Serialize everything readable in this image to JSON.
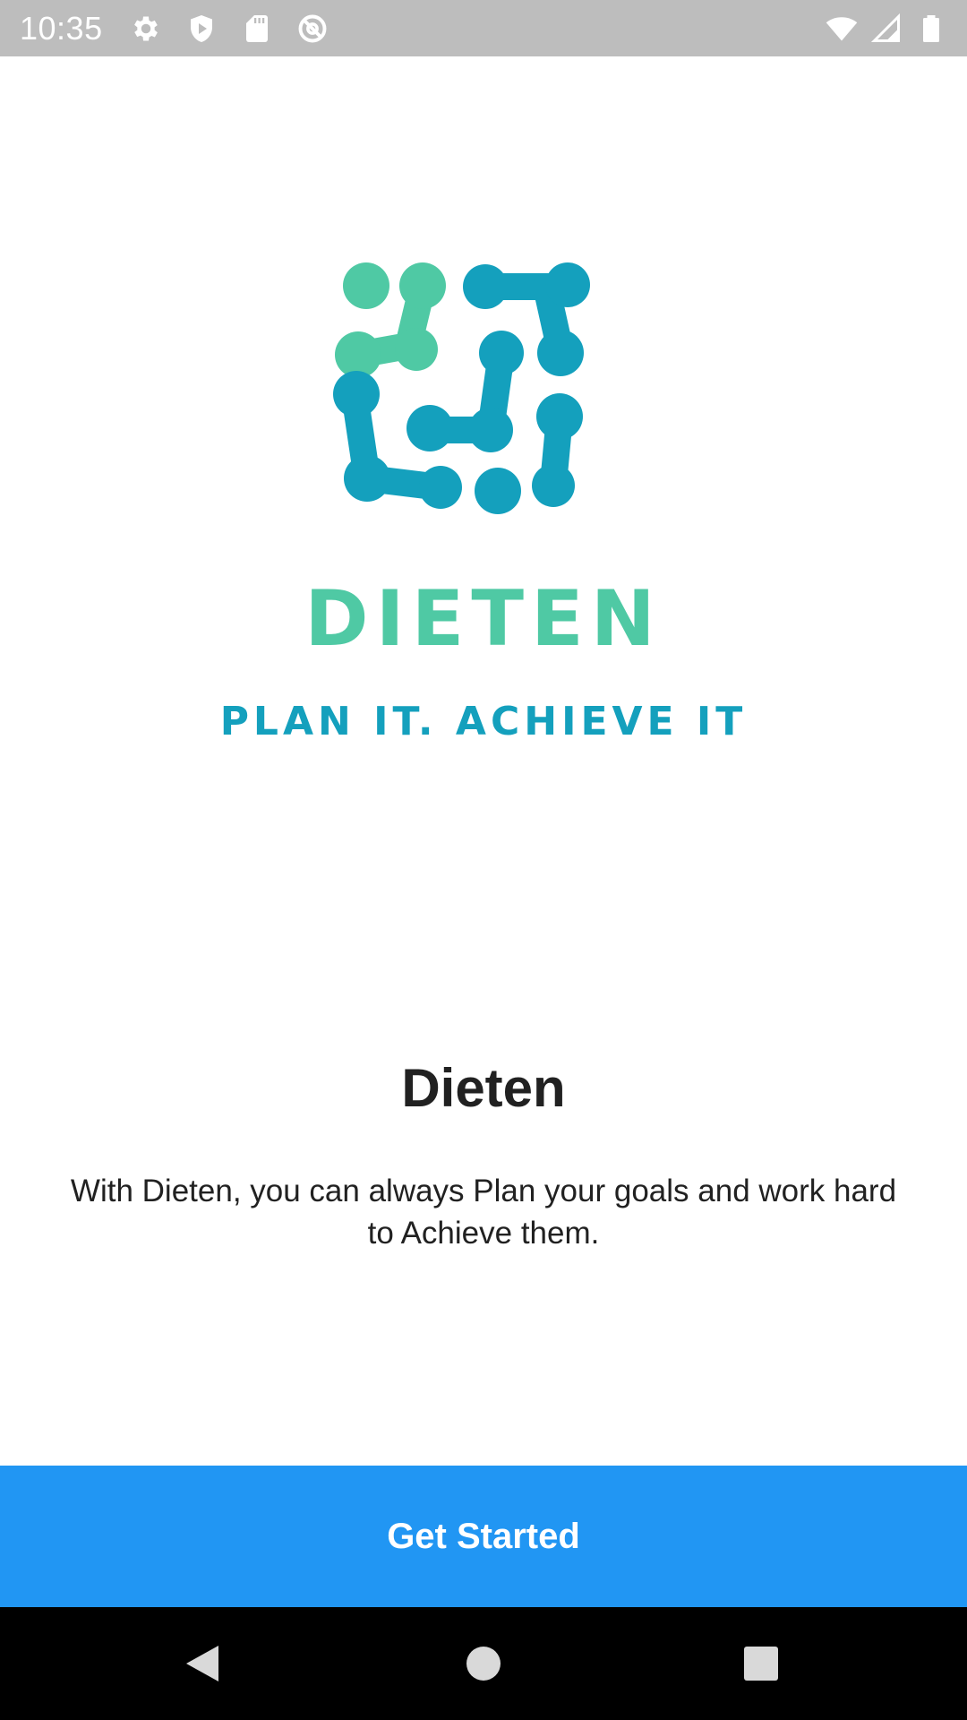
{
  "status_bar": {
    "time": "10:35",
    "left_icons": [
      "settings-icon",
      "shield-icon",
      "sd-card-icon",
      "do-not-disturb-icon"
    ],
    "right_icons": [
      "wifi-icon",
      "cellular-signal-icon",
      "battery-icon"
    ]
  },
  "logo": {
    "brand_name": "DIETEN",
    "tagline": "PLAN IT. ACHIEVE IT",
    "colors": {
      "green": "#4fc9a4",
      "teal": "#14a0bd"
    }
  },
  "onboarding": {
    "title": "Dieten",
    "description": "With Dieten, you can always Plan your goals and work hard to Achieve them."
  },
  "cta": {
    "label": "Get Started",
    "color": "#2196f3"
  },
  "nav_bar": {
    "buttons": [
      "back-icon",
      "home-icon",
      "recents-icon"
    ]
  }
}
